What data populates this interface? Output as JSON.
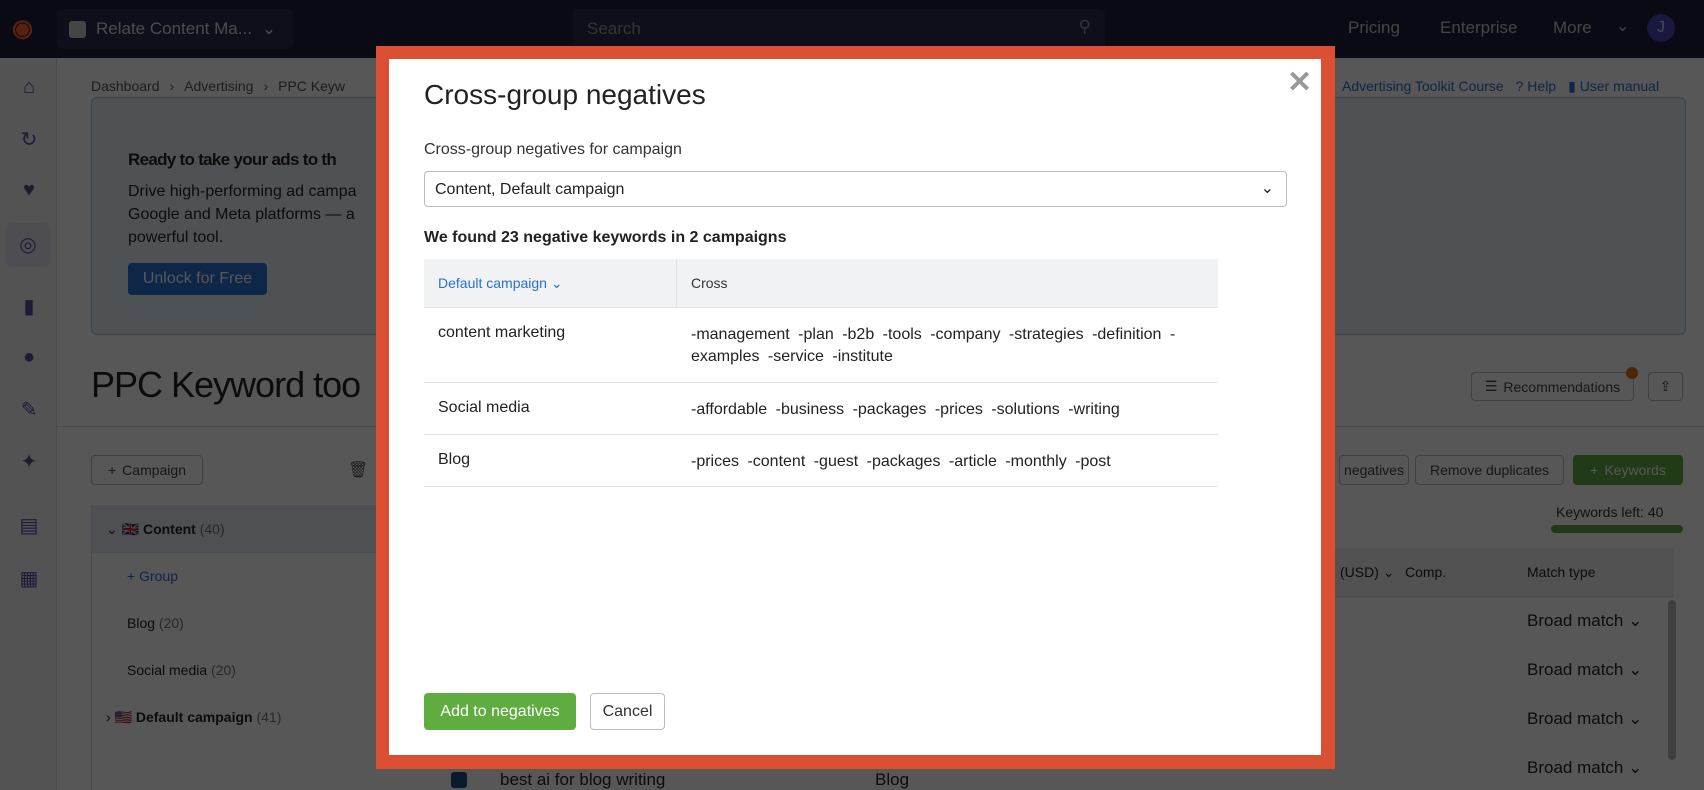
{
  "topbar": {
    "project": "Relate Content Ma...",
    "search_placeholder": "Search",
    "links": [
      "Pricing",
      "Enterprise",
      "More"
    ],
    "avatar": "J"
  },
  "breadcrumb": [
    "Dashboard",
    "Advertising",
    "PPC Keyw"
  ],
  "header_links": {
    "course": "Advertising Toolkit Course",
    "help": "Help",
    "manual": "User manual"
  },
  "banner": {
    "title": "Ready to take your ads to th",
    "lines": [
      "Drive high-performing ad campa",
      "Google and Meta platforms — a",
      "powerful tool."
    ],
    "button": "Unlock for Free"
  },
  "page": {
    "title": "PPC Keyword too",
    "recommendations": "Recommendations"
  },
  "toolbar": {
    "campaign": "Campaign",
    "negatives": "negatives",
    "remove_duplicates": "Remove duplicates",
    "keywords": "Keywords",
    "keywords_left": "Keywords left: 40"
  },
  "tree": {
    "content": "Content",
    "content_count": "(40)",
    "group": "Group",
    "blog": "Blog",
    "blog_count": "(20)",
    "social": "Social media",
    "social_count": "(20)",
    "default": "Default campaign",
    "default_count": "(41)"
  },
  "table": {
    "col_cpc": "(USD)",
    "col_comp": "Comp.",
    "col_match": "Match type",
    "match_values": [
      "Broad match",
      "Broad match",
      "Broad match",
      "Broad match"
    ],
    "bottom_keyword": "best ai for blog writing",
    "bottom_group": "Blog"
  },
  "modal": {
    "title": "Cross-group negatives",
    "select_label": "Cross-group negatives for campaign",
    "select_value": "Content, Default campaign",
    "summary": "We found 23 negative keywords in 2 campaigns",
    "col1": "Default campaign",
    "col2": "Cross",
    "rows": [
      {
        "group": "content marketing",
        "negatives": "-management -plan -b2b -tools -company -strategies -definition -examples -service -institute"
      },
      {
        "group": "Social media",
        "negatives": "-affordable -business -packages -prices -solutions -writing"
      },
      {
        "group": "Blog",
        "negatives": "-prices -content -guest -packages -article -monthly -post"
      }
    ],
    "add_button": "Add to negatives",
    "cancel_button": "Cancel"
  },
  "colors": {
    "accent_frame": "#db5033",
    "primary_green": "#5fad41",
    "link_blue": "#2a6fd0"
  }
}
